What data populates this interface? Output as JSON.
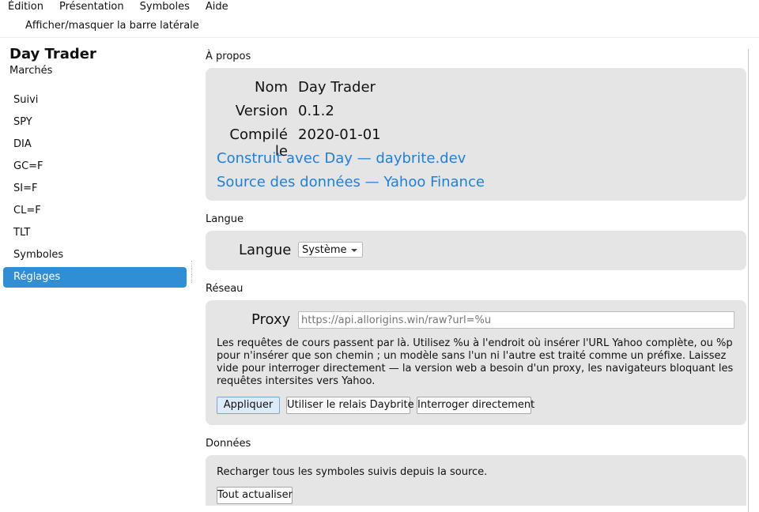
{
  "menu": [
    "Édition",
    "Présentation",
    "Symboles",
    "Aide"
  ],
  "toolbar": {
    "toggle_sidebar": "Afficher/masquer la barre latérale"
  },
  "sidebar": {
    "title": "Day Trader",
    "subtitle": "Marchés",
    "items": [
      "Suivi",
      "SPY",
      "DIA",
      "GC=F",
      "SI=F",
      "CL=F",
      "TLT",
      "Symboles",
      "Réglages"
    ],
    "active": "Réglages"
  },
  "about": {
    "heading": "À propos",
    "name_label": "Nom",
    "name_value": "Day Trader",
    "version_label": "Version",
    "version_value": "0.1.2",
    "built_label": "Compilé le",
    "built_value": "2020-01-01",
    "link_built": "Construit avec Day — daybrite.dev",
    "link_source": "Source des données — Yahoo Finance"
  },
  "language": {
    "heading": "Langue",
    "label": "Langue",
    "selected": "Système"
  },
  "network": {
    "heading": "Réseau",
    "proxy_label": "Proxy",
    "proxy_placeholder": "https://api.allorigins.win/raw?url=%u",
    "help": "Les requêtes de cours passent par là. Utilisez %u à l'endroit où insérer l'URL Yahoo complète, ou %p pour n'insérer que son chemin ; un modèle sans l'un ni l'autre est traité comme un préfixe. Laissez vide pour interroger directement — la version web a besoin d'un proxy, les navigateurs bloquant les requêtes intersites vers Yahoo.",
    "apply": "Appliquer",
    "use_relay": "Utiliser le relais Daybrite",
    "direct": "Interroger directement"
  },
  "data": {
    "heading": "Données",
    "description": "Recharger tous les symboles suivis depuis la source.",
    "refresh": "Tout actualiser"
  },
  "colors": {
    "accent": "#2f8ed4",
    "link": "#1e80d6",
    "card": "#e5e5e5"
  }
}
